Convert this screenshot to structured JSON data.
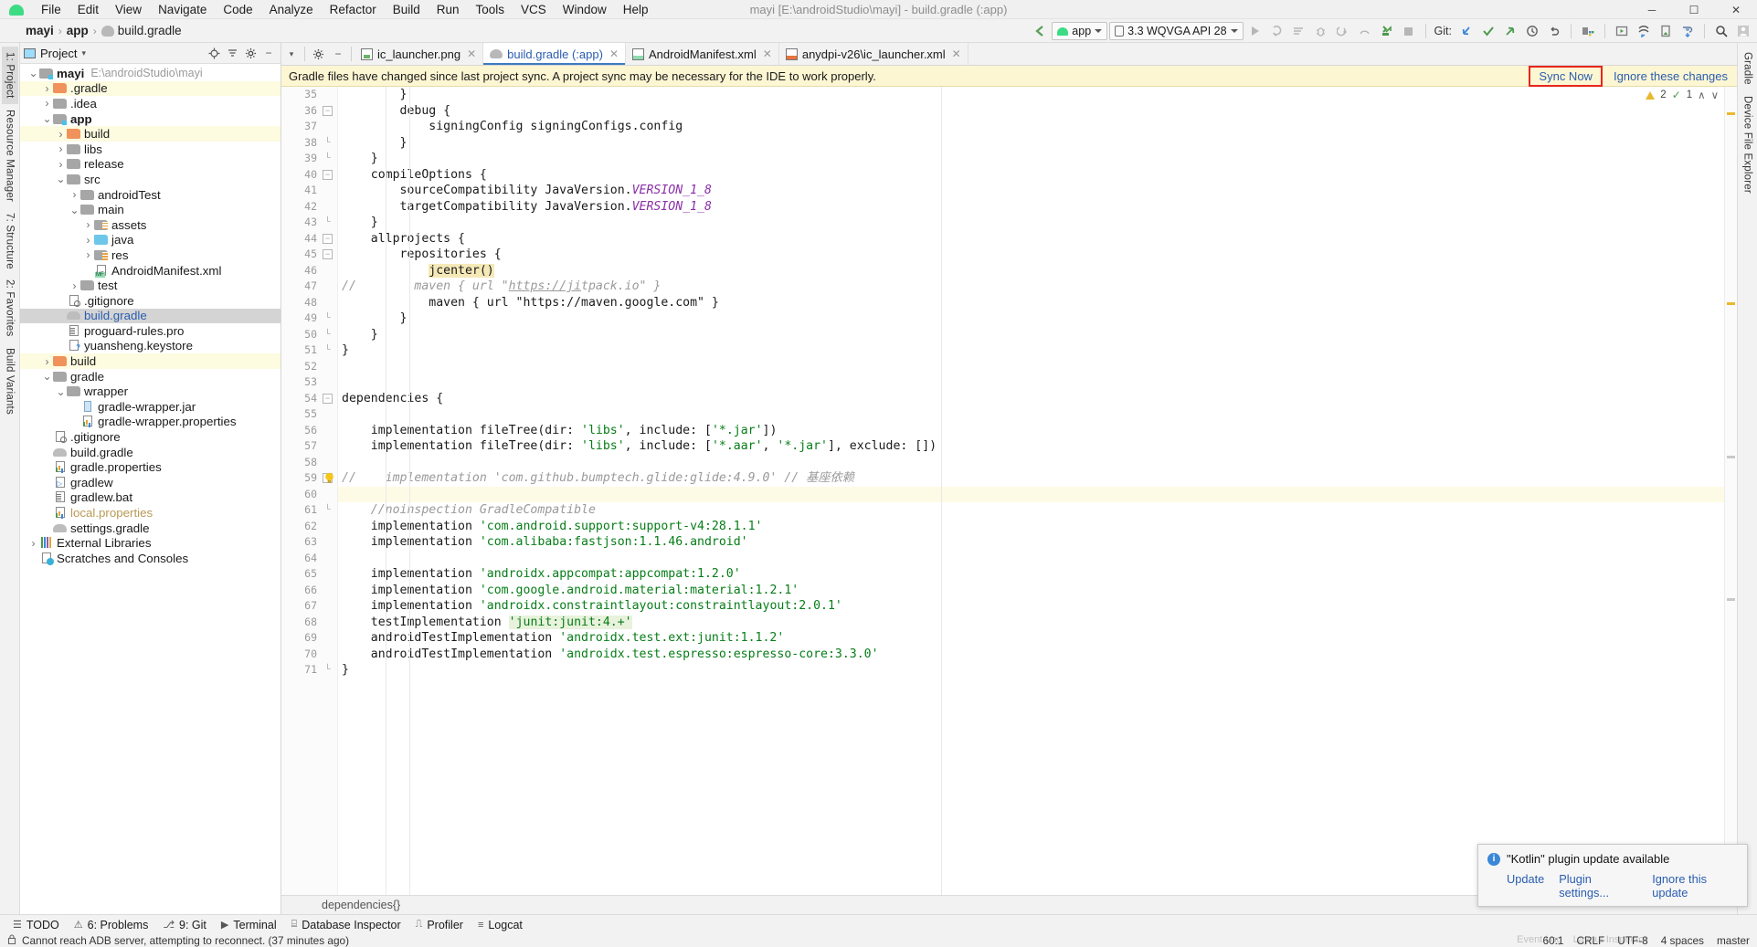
{
  "window": {
    "title": "mayi [E:\\androidStudio\\mayi] - build.gradle (:app)",
    "minimize": "─",
    "maximize": "☐",
    "close": "✕"
  },
  "menu": {
    "logo_name": "android-logo-icon",
    "items": [
      "File",
      "Edit",
      "View",
      "Navigate",
      "Code",
      "Analyze",
      "Refactor",
      "Build",
      "Run",
      "Tools",
      "VCS",
      "Window",
      "Help"
    ]
  },
  "navbar": {
    "breadcrumb": [
      "mayi",
      "app",
      "build.gradle"
    ],
    "separator": "›",
    "back_icon": "back-arrow-icon",
    "run_config": "app",
    "device": "3.3  WQVGA API 28",
    "git_label": "Git:",
    "run_icons": [
      "run-icon",
      "apply-changes-icon",
      "apply-code-changes-icon",
      "debug-icon",
      "attach-debugger-icon",
      "profiler-icon",
      "avd-manager-icon",
      "stop-icon"
    ],
    "git_icons": [
      "update-project-icon",
      "commit-icon",
      "push-icon",
      "history-icon",
      "rollback-icon"
    ],
    "right_icons": [
      "sdk-manager-icon",
      "avd-icon",
      "layout-inspector-icon",
      "device-file-explorer-icon",
      "sync-project-icon",
      "search-icon",
      "profile-icon"
    ]
  },
  "left_rail": {
    "items": [
      "1: Project",
      "Resource Manager",
      "7: Structure",
      "2: Favorites",
      "Build Variants"
    ]
  },
  "right_rail": {
    "items": [
      "Gradle",
      "Device File Explorer"
    ]
  },
  "project_panel": {
    "title": "Project",
    "caret": "▾",
    "buttons": [
      "locate-icon",
      "collapse-all-icon",
      "settings-icon",
      "hide-icon"
    ],
    "tree": [
      {
        "depth": 0,
        "arrow": "v",
        "icon": "folder-module",
        "label": "mayi",
        "bold": true,
        "path": "E:\\androidStudio\\mayi",
        "state": "normal"
      },
      {
        "depth": 1,
        "arrow": ">",
        "icon": "folder-orange",
        "label": ".gradle",
        "state": "hl"
      },
      {
        "depth": 1,
        "arrow": ">",
        "icon": "folder",
        "label": ".idea",
        "state": "normal"
      },
      {
        "depth": 1,
        "arrow": "v",
        "icon": "folder-module",
        "label": "app",
        "bold": true,
        "state": "normal"
      },
      {
        "depth": 2,
        "arrow": ">",
        "icon": "folder-orange",
        "label": "build",
        "state": "hl"
      },
      {
        "depth": 2,
        "arrow": ">",
        "icon": "folder",
        "label": "libs",
        "state": "normal"
      },
      {
        "depth": 2,
        "arrow": ">",
        "icon": "folder",
        "label": "release",
        "state": "normal"
      },
      {
        "depth": 2,
        "arrow": "v",
        "icon": "folder",
        "label": "src",
        "state": "normal"
      },
      {
        "depth": 3,
        "arrow": ">",
        "icon": "folder",
        "label": "androidTest",
        "state": "normal"
      },
      {
        "depth": 3,
        "arrow": "v",
        "icon": "folder",
        "label": "main",
        "state": "normal"
      },
      {
        "depth": 4,
        "arrow": ">",
        "icon": "folder-res",
        "label": "assets",
        "state": "normal"
      },
      {
        "depth": 4,
        "arrow": ">",
        "icon": "folder-blue",
        "label": "java",
        "state": "normal"
      },
      {
        "depth": 4,
        "arrow": ">",
        "icon": "folder-res",
        "label": "res",
        "state": "normal"
      },
      {
        "depth": 4,
        "arrow": "",
        "icon": "manifest-file",
        "label": "AndroidManifest.xml",
        "state": "normal"
      },
      {
        "depth": 3,
        "arrow": ">",
        "icon": "folder",
        "label": "test",
        "state": "normal"
      },
      {
        "depth": 2,
        "arrow": "",
        "icon": "gitignore-file",
        "label": ".gitignore",
        "state": "normal"
      },
      {
        "depth": 2,
        "arrow": "",
        "icon": "gradle-file",
        "label": "build.gradle",
        "state": "sel"
      },
      {
        "depth": 2,
        "arrow": "",
        "icon": "text-file",
        "label": "proguard-rules.pro",
        "state": "normal"
      },
      {
        "depth": 2,
        "arrow": "",
        "icon": "keystore-file",
        "label": "yuansheng.keystore",
        "state": "normal"
      },
      {
        "depth": 1,
        "arrow": ">",
        "icon": "folder-orange",
        "label": "build",
        "state": "hl"
      },
      {
        "depth": 1,
        "arrow": "v",
        "icon": "folder",
        "label": "gradle",
        "state": "normal"
      },
      {
        "depth": 2,
        "arrow": "v",
        "icon": "folder",
        "label": "wrapper",
        "state": "normal"
      },
      {
        "depth": 3,
        "arrow": "",
        "icon": "jar-file",
        "label": "gradle-wrapper.jar",
        "state": "normal"
      },
      {
        "depth": 3,
        "arrow": "",
        "icon": "properties-file",
        "label": "gradle-wrapper.properties",
        "state": "normal"
      },
      {
        "depth": 1,
        "arrow": "",
        "icon": "gitignore-file",
        "label": ".gitignore",
        "state": "normal"
      },
      {
        "depth": 1,
        "arrow": "",
        "icon": "gradle-file",
        "label": "build.gradle",
        "state": "normal"
      },
      {
        "depth": 1,
        "arrow": "",
        "icon": "properties-file",
        "label": "gradle.properties",
        "state": "normal"
      },
      {
        "depth": 1,
        "arrow": "",
        "icon": "script-file",
        "label": "gradlew",
        "state": "normal"
      },
      {
        "depth": 1,
        "arrow": "",
        "icon": "text-file",
        "label": "gradlew.bat",
        "state": "normal"
      },
      {
        "depth": 1,
        "arrow": "",
        "icon": "properties-file",
        "label": "local.properties",
        "state": "ignored"
      },
      {
        "depth": 1,
        "arrow": "",
        "icon": "gradle-file",
        "label": "settings.gradle",
        "state": "normal"
      },
      {
        "depth": 0,
        "arrow": ">",
        "icon": "libraries",
        "label": "External Libraries",
        "state": "normal"
      },
      {
        "depth": 0,
        "arrow": "",
        "icon": "scratches",
        "label": "Scratches and Consoles",
        "state": "normal"
      }
    ]
  },
  "editor": {
    "tabs": [
      {
        "label": "ic_launcher.png",
        "icon": "png-file-icon",
        "active": false,
        "closable": true
      },
      {
        "label": "build.gradle (:app)",
        "icon": "gradle-file-icon",
        "active": true,
        "closable": true
      },
      {
        "label": "AndroidManifest.xml",
        "icon": "manifest-file-icon",
        "active": false,
        "closable": true
      },
      {
        "label": "anydpi-v26\\ic_launcher.xml",
        "icon": "xml-file-icon",
        "active": false,
        "closable": true
      }
    ],
    "notification": {
      "message": "Gradle files have changed since last project sync. A project sync may be necessary for the IDE to work properly.",
      "sync_label": "Sync Now",
      "ignore_label": "Ignore these changes"
    },
    "inspection": {
      "warnings": "2",
      "checks": "1",
      "up": "∧",
      "down": "∨"
    },
    "breadcrumb": "dependencies{}",
    "first_line": 35,
    "lines": [
      {
        "n": 35,
        "text": "        }",
        "fold": ""
      },
      {
        "n": 36,
        "text": "        debug {",
        "fold": "minus"
      },
      {
        "n": 37,
        "text": "            signingConfig signingConfigs.config",
        "fold": ""
      },
      {
        "n": 38,
        "text": "        }",
        "fold": "end"
      },
      {
        "n": 39,
        "text": "    }",
        "fold": "end"
      },
      {
        "n": 40,
        "text": "    compileOptions {",
        "fold": "minus"
      },
      {
        "n": 41,
        "text": "        sourceCompatibility JavaVersion.VERSION_1_8",
        "fold": ""
      },
      {
        "n": 42,
        "text": "        targetCompatibility JavaVersion.VERSION_1_8",
        "fold": ""
      },
      {
        "n": 43,
        "text": "    }",
        "fold": "end"
      },
      {
        "n": 44,
        "text": "    allprojects {",
        "fold": "minus"
      },
      {
        "n": 45,
        "text": "        repositories {",
        "fold": "minus"
      },
      {
        "n": 46,
        "text": "            jcenter()",
        "fold": ""
      },
      {
        "n": 47,
        "text": "//        maven { url \"https://jitpack.io\" }",
        "fold": ""
      },
      {
        "n": 48,
        "text": "            maven { url \"https://maven.google.com\" }",
        "fold": ""
      },
      {
        "n": 49,
        "text": "        }",
        "fold": "end"
      },
      {
        "n": 50,
        "text": "    }",
        "fold": "end"
      },
      {
        "n": 51,
        "text": "}",
        "fold": "end"
      },
      {
        "n": 52,
        "text": "",
        "fold": ""
      },
      {
        "n": 53,
        "text": "",
        "fold": ""
      },
      {
        "n": 54,
        "text": "dependencies {",
        "fold": "minus"
      },
      {
        "n": 55,
        "text": "",
        "fold": ""
      },
      {
        "n": 56,
        "text": "    implementation fileTree(dir: 'libs', include: ['*.jar'])",
        "fold": ""
      },
      {
        "n": 57,
        "text": "    implementation fileTree(dir: 'libs', include: ['*.aar', '*.jar'], exclude: [])",
        "fold": ""
      },
      {
        "n": 58,
        "text": "",
        "fold": ""
      },
      {
        "n": 59,
        "text": "//    implementation 'com.github.bumptech.glide:glide:4.9.0' // 基座依赖",
        "fold": "minus"
      },
      {
        "n": 60,
        "text": "",
        "fold": ""
      },
      {
        "n": 61,
        "text": "    //noinspection GradleCompatible",
        "fold": "end"
      },
      {
        "n": 62,
        "text": "    implementation 'com.android.support:support-v4:28.1.1'",
        "fold": ""
      },
      {
        "n": 63,
        "text": "    implementation 'com.alibaba:fastjson:1.1.46.android'",
        "fold": ""
      },
      {
        "n": 64,
        "text": "",
        "fold": ""
      },
      {
        "n": 65,
        "text": "    implementation 'androidx.appcompat:appcompat:1.2.0'",
        "fold": ""
      },
      {
        "n": 66,
        "text": "    implementation 'com.google.android.material:material:1.2.1'",
        "fold": ""
      },
      {
        "n": 67,
        "text": "    implementation 'androidx.constraintlayout:constraintlayout:2.0.1'",
        "fold": ""
      },
      {
        "n": 68,
        "text": "    testImplementation 'junit:junit:4.+'",
        "fold": ""
      },
      {
        "n": 69,
        "text": "    androidTestImplementation 'androidx.test.ext:junit:1.1.2'",
        "fold": ""
      },
      {
        "n": 70,
        "text": "    androidTestImplementation 'androidx.test.espresso:espresso-core:3.3.0'",
        "fold": ""
      },
      {
        "n": 71,
        "text": "}",
        "fold": "end"
      }
    ]
  },
  "bottom_tools": [
    {
      "label": "TODO",
      "icon": "todo-icon"
    },
    {
      "label": "6: Problems",
      "icon": "problems-icon"
    },
    {
      "label": "9: Git",
      "icon": "git-icon"
    },
    {
      "label": "Terminal",
      "icon": "terminal-icon"
    },
    {
      "label": "Database Inspector",
      "icon": "database-icon"
    },
    {
      "label": "Profiler",
      "icon": "profiler-icon"
    },
    {
      "label": "Logcat",
      "icon": "logcat-icon"
    }
  ],
  "statusbar": {
    "message": "Cannot reach ADB server, attempting to reconnect. (37 minutes ago)",
    "caret": "60:1",
    "line_sep": "CRLF",
    "encoding": "UTF-8",
    "indent": "4 spaces",
    "branch": "master",
    "lock_icon": "lock-icon"
  },
  "kotlin_popup": {
    "title": "\"Kotlin\" plugin update available",
    "update_label": "Update",
    "settings_label": "Plugin settings...",
    "ignore_label": "Ignore this update",
    "info_icon": "info-icon"
  },
  "ghost_bar": {
    "items": [
      "Event Log",
      "Layout Inspector"
    ]
  },
  "colors": {
    "accent_blue": "#2a5db0",
    "highlight_yellow": "#fdf6d3",
    "sync_border_red": "#e8261e",
    "string_green": "#067d17",
    "folder_orange": "#f0925b",
    "android_green": "#3ddc84"
  }
}
